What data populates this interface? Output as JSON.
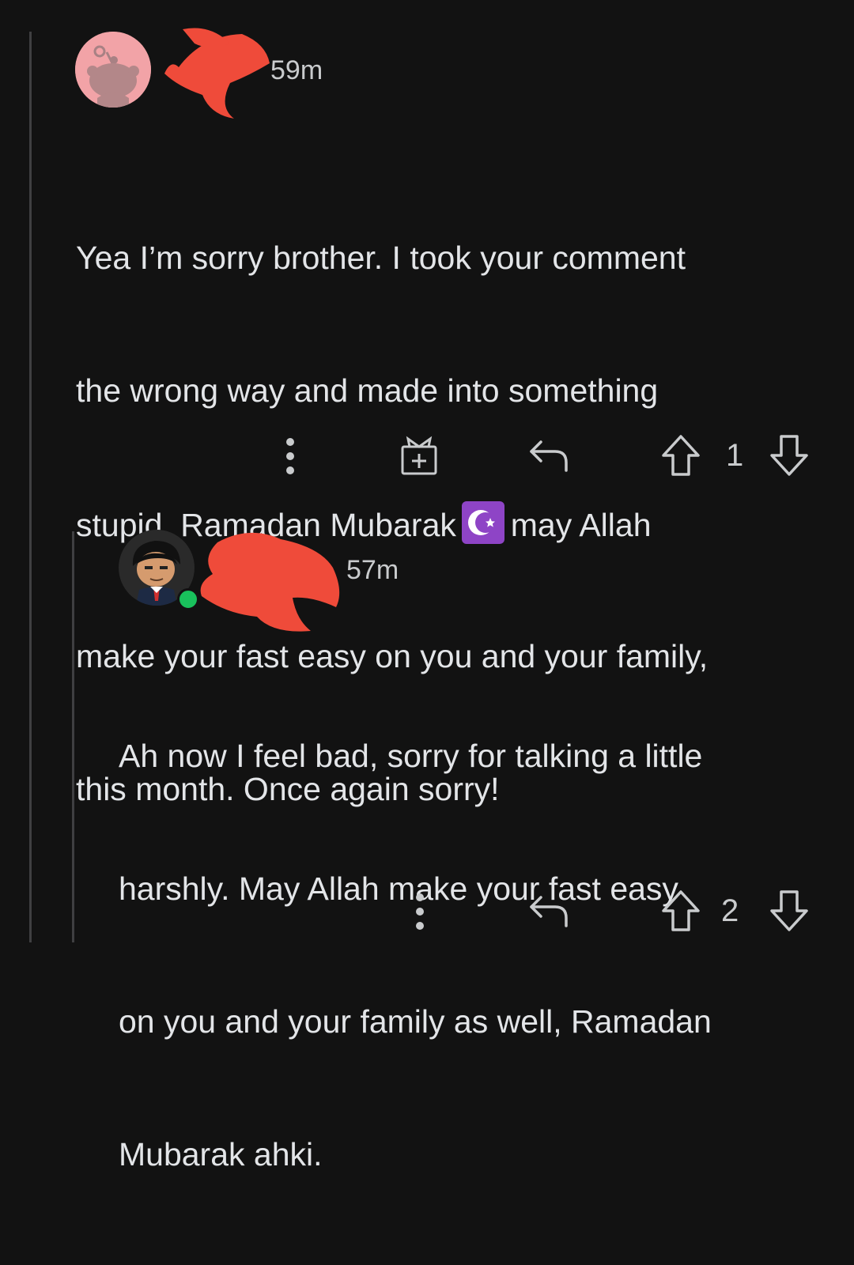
{
  "comments": [
    {
      "timestamp": "59m",
      "body_lines": [
        "Yea I’m sorry brother. I took your comment",
        "the wrong way and made into something",
        "stupid. Ramadan Mubarak",
        "may Allah",
        "make your fast easy on you and your family,",
        "this month. Once again sorry!"
      ],
      "emoji": "star-and-crescent-icon",
      "vote_count": "1"
    },
    {
      "timestamp": "57m",
      "body_lines": [
        "Ah now I feel bad, sorry for talking a little",
        "harshly. May Allah make your fast easy",
        "on you and your family as well, Ramadan",
        "Mubarak ahki."
      ],
      "online": true,
      "vote_count": "2"
    }
  ],
  "colors": {
    "background": "#121212",
    "text": "#e3e5e8",
    "icon": "#c9cbcd",
    "thread_line": "#3f3f41",
    "redaction": "#ef4b3a",
    "online_dot": "#19c15c",
    "emoji_bg": "#8e44c6"
  }
}
